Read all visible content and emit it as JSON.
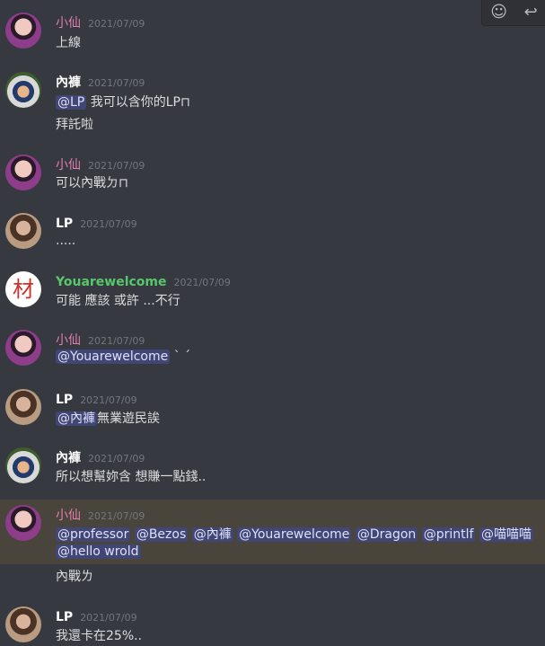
{
  "toolbar": {
    "react_icon": "add-reaction-icon",
    "reply_icon": "reply-icon"
  },
  "messages": [
    {
      "author": "小仙",
      "time": "2021/07/09",
      "lines": [
        "上線"
      ]
    },
    {
      "author": "內褲",
      "time": "2021/07/09",
      "mention": "@LP",
      "text1": " 我可以含你的LP⊓",
      "line2": "拜託啦"
    },
    {
      "author": "小仙",
      "time": "2021/07/09",
      "lines": [
        "可以內戰ㄉ⊓"
      ]
    },
    {
      "author": "LP",
      "time": "2021/07/09",
      "lines": [
        "....."
      ]
    },
    {
      "author": "Youarewelcome",
      "time": "2021/07/09",
      "lines": [
        "可能 應該 或許 ...不行"
      ],
      "avatar_glyph": "材"
    },
    {
      "author": "小仙",
      "time": "2021/07/09",
      "mention": "@Youarewelcome",
      "text1": "  ` ´"
    },
    {
      "author": "LP",
      "time": "2021/07/09",
      "mention": "@內褲",
      "text1": "無業遊民誒"
    },
    {
      "author": "內褲",
      "time": "2021/07/09",
      "lines": [
        "所以想幫妳含 想賺一點錢.."
      ]
    },
    {
      "author": "小仙",
      "time": "2021/07/09",
      "mentions": [
        "@professor",
        "@Bezos",
        "@內褲",
        "@Youarewelcome",
        "@Dragon",
        "@printlf",
        "@喵喵喵",
        "@hello wrold"
      ],
      "line3": "內戰ㄌ"
    },
    {
      "author": "LP",
      "time": "2021/07/09",
      "lines": [
        "我還卡在25%.."
      ]
    }
  ]
}
